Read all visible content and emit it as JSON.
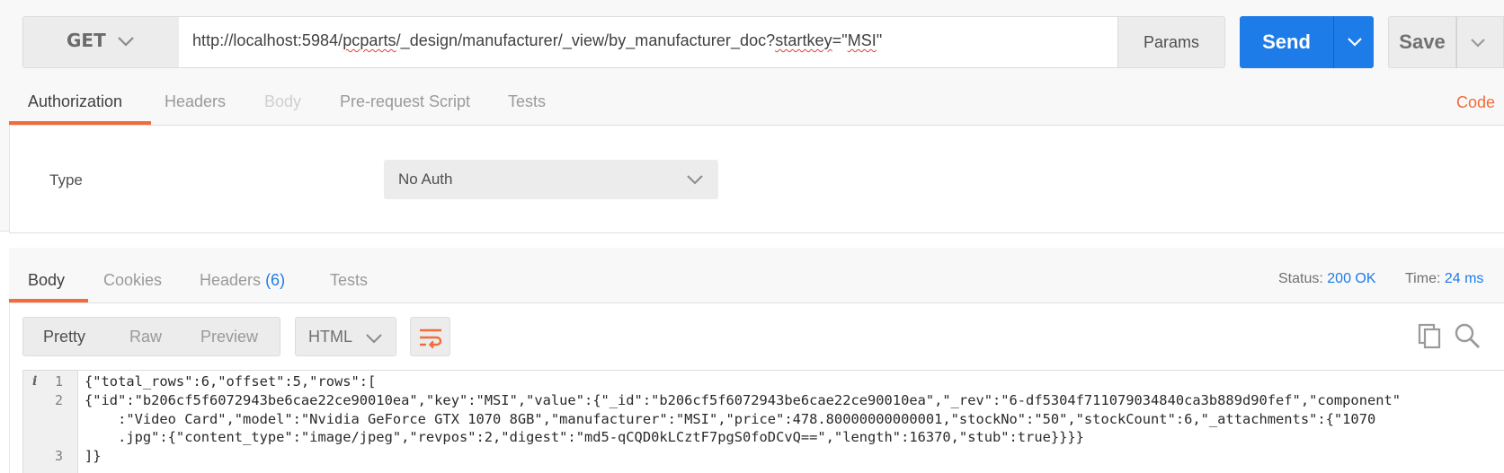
{
  "request": {
    "method": "GET",
    "url_parts": [
      {
        "t": "http://localhost:5984/",
        "sq": false
      },
      {
        "t": "pcparts",
        "sq": true
      },
      {
        "t": "/_design/manufacturer/_view/by_manufacturer_doc?",
        "sq": false
      },
      {
        "t": "startkey",
        "sq": true
      },
      {
        "t": "=\"",
        "sq": false
      },
      {
        "t": "MSI",
        "sq": true
      },
      {
        "t": "\"",
        "sq": false
      }
    ],
    "params_label": "Params",
    "send_label": "Send",
    "save_label": "Save"
  },
  "request_tabs": {
    "authorization": "Authorization",
    "headers": "Headers",
    "body": "Body",
    "prerequest": "Pre-request Script",
    "tests": "Tests",
    "code": "Code"
  },
  "auth": {
    "type_label": "Type",
    "selected": "No Auth"
  },
  "response_tabs": {
    "body": "Body",
    "cookies": "Cookies",
    "headers": "Headers",
    "headers_count": "(6)",
    "tests": "Tests"
  },
  "status": {
    "status_label": "Status:",
    "status_value": "200 OK",
    "time_label": "Time:",
    "time_value": "24 ms"
  },
  "view": {
    "pretty": "Pretty",
    "raw": "Raw",
    "preview": "Preview",
    "format": "HTML"
  },
  "code": {
    "info_glyph": "i",
    "line_numbers": [
      "1",
      "2",
      "3"
    ],
    "lines": [
      "{\"total_rows\":6,\"offset\":5,\"rows\":[",
      "{\"id\":\"b206cf5f6072943be6cae22ce90010ea\",\"key\":\"MSI\",\"value\":{\"_id\":\"b206cf5f6072943be6cae22ce90010ea\",\"_rev\":\"6-df5304f711079034840ca3b889d90fef\",\"component\"",
      "    :\"Video Card\",\"model\":\"Nvidia GeForce GTX 1070 8GB\",\"manufacturer\":\"MSI\",\"price\":478.80000000000001,\"stockNo\":\"50\",\"stockCount\":6,\"_attachments\":{\"1070",
      "    .jpg\":{\"content_type\":\"image/jpeg\",\"revpos\":2,\"digest\":\"md5-qCQD0kLCztF7pgS0foDCvQ==\",\"length\":16370,\"stub\":true}}}}",
      "]}"
    ]
  },
  "colors": {
    "accent_orange": "#f26b3a",
    "accent_blue": "#1e7ce8"
  }
}
